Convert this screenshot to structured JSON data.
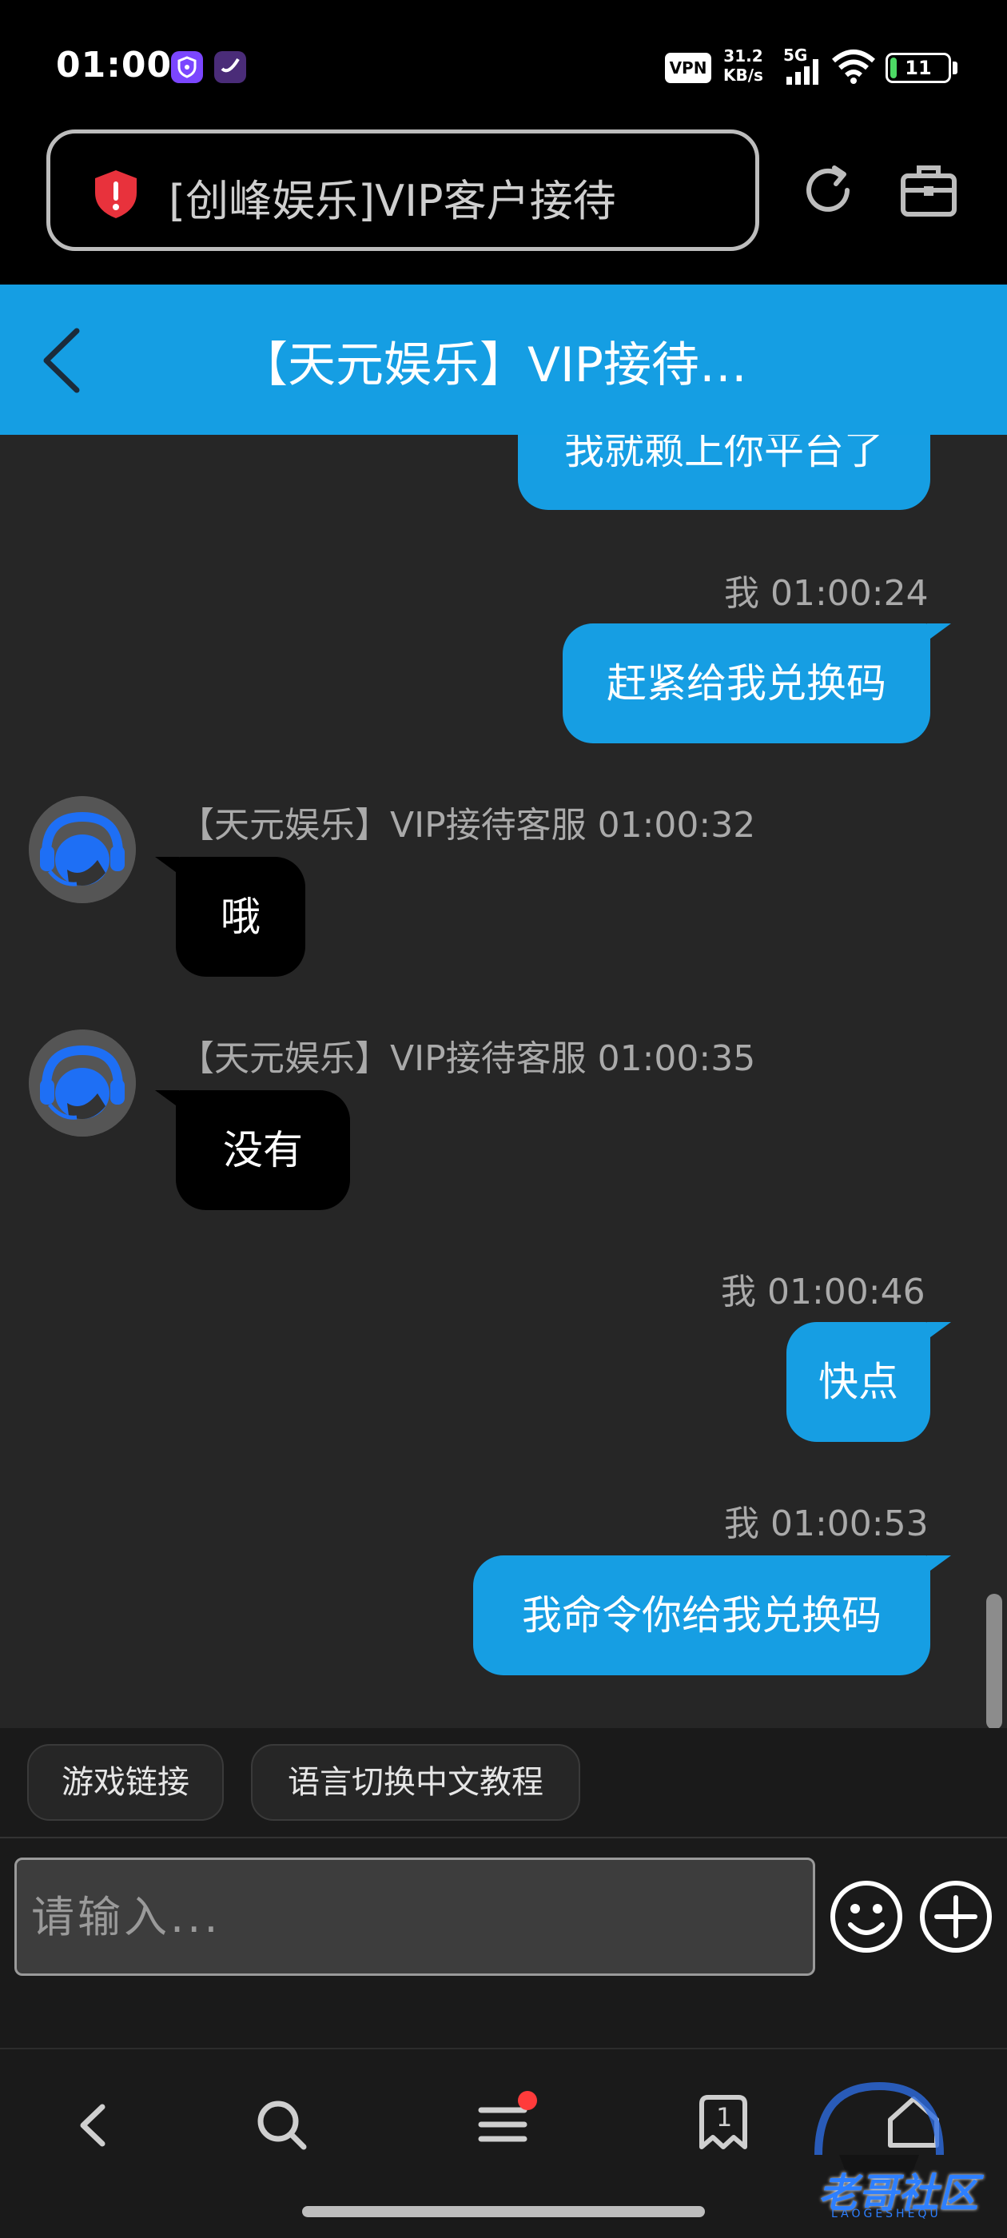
{
  "status_bar": {
    "time": "01:00",
    "vpn": "VPN",
    "net_speed_value": "31.2",
    "net_speed_unit": "KB/s",
    "network": "5G",
    "battery": "11",
    "battery_level": 0.11
  },
  "browser": {
    "url_title": "[创峰娱乐]VIP客户接待"
  },
  "header": {
    "title": "【天元娱乐】VIP接待…"
  },
  "chat": {
    "messages": [
      {
        "sender": "me",
        "time": "",
        "text": "我就赖上你平台了"
      },
      {
        "sender": "me",
        "time": "我 01:00:24",
        "text": "赶紧给我兑换码"
      },
      {
        "sender": "agent",
        "time": "【天元娱乐】VIP接待客服 01:00:32",
        "text": "哦"
      },
      {
        "sender": "agent",
        "time": "【天元娱乐】VIP接待客服 01:00:35",
        "text": "没有"
      },
      {
        "sender": "me",
        "time": "我 01:00:46",
        "text": "快点"
      },
      {
        "sender": "me",
        "time": "我 01:00:53",
        "text": "我命令你给我兑换码"
      }
    ]
  },
  "quick_replies": [
    "游戏链接",
    "语言切换中文教程"
  ],
  "input": {
    "placeholder": "请输入..."
  },
  "watermark": {
    "text": "老哥社区",
    "sub": "LAOGESHEQU"
  },
  "nav": {
    "tabs_count": "1"
  },
  "colors": {
    "accent": "#159ee3",
    "chat_bg": "#262626",
    "agent_bubble": "#000000"
  }
}
